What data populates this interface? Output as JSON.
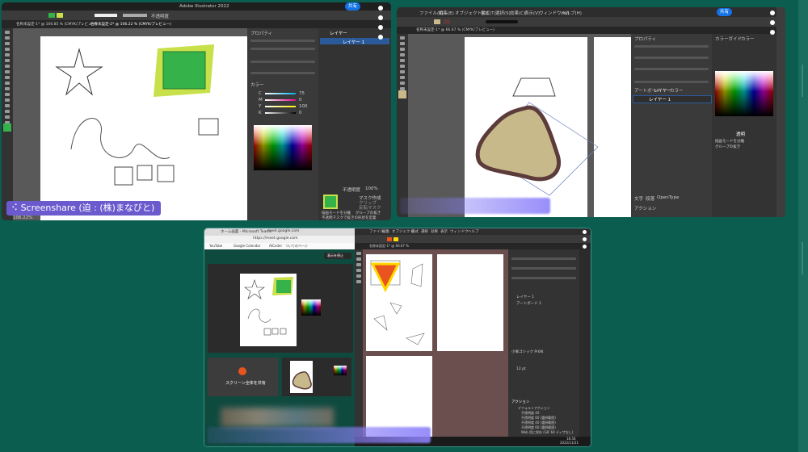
{
  "left_window": {
    "app_title": "Adobe Illustrator 2022",
    "share_label": "共有",
    "doc_tabs": [
      "名称未設定-1* @ 106.85 % (CMYK/プレビュー)",
      "名称未設定-2* @ 106.22 % (CMYK/プレビュー)"
    ],
    "panel_tabs": [
      "プロパティ",
      "レイヤー",
      "ライブラリ"
    ],
    "layer_name": "レイヤー 1",
    "swatch_tabs": [
      "カラー",
      "カラーガイド",
      "スウォッチ",
      "ブラシ",
      "シンボル"
    ],
    "color_channels": [
      {
        "label": "C",
        "value": "75"
      },
      {
        "label": "M",
        "value": "0"
      },
      {
        "label": "Y",
        "value": "100"
      },
      {
        "label": "K",
        "value": "0"
      }
    ],
    "opacity_label": "不透明度",
    "opacity_value": "100%",
    "mask_button": "マスク作成",
    "mask_options": [
      "クリップ",
      "反転マスク"
    ],
    "checkbox_group": "グループの抜き",
    "checkbox_clip": "描画モードを分離",
    "checkbox_define": "不透明マスクで抜きの形状を定義",
    "zoom_value": "106.22%",
    "screenshare_badge": "Screenshare (迫 : (株)まなびと)"
  },
  "right_window": {
    "menu": [
      "ファイル(F)",
      "編集(E)",
      "オブジェクト(O)",
      "書式(T)",
      "選択(S)",
      "効果(C)",
      "表示(V)",
      "ウィンドウ(W)",
      "ヘルプ(H)"
    ],
    "share_label": "共有",
    "doc_tab": "名称未設定-1* @ 66.67 % (CMYK/プレビュー)",
    "panel_tabs": [
      "プロパティ",
      "ライブラリ"
    ],
    "layer_tabs": [
      "アートボード",
      "レイヤー",
      "カラー"
    ],
    "layer_name": "レイヤー 1",
    "swatch_tabs": [
      "カラーガイド",
      "カラー"
    ],
    "transparency_tab": "透明",
    "checkbox_a": "描画モードを分離",
    "checkbox_b": "グループの抜き",
    "bottom_tabs": [
      "文字",
      "段落",
      "OpenType"
    ],
    "action_tab": "アクション"
  },
  "bottom_window": {
    "browser_tabs": [
      "ホーム画面 - Microsoft Teams",
      "meet.google.com"
    ],
    "url": "https://meet.google.com",
    "bookmarks": [
      "YouTube",
      "Google Calendar",
      "AtCoder",
      "ついてのページ"
    ],
    "screen_share_banner": "スクリーン全体を共有",
    "share_action": "表示を停止",
    "ai_doc_tab": "名称未設定-1* @ 66.67 %",
    "menu": [
      "ファイル",
      "編集",
      "オブジェクト",
      "書式",
      "選択",
      "効果",
      "表示",
      "ウィンドウ",
      "ヘルプ"
    ],
    "layer_items": [
      "レイヤー 1",
      "アートボード 1"
    ],
    "font_name": "小塚ゴシック Pr6N",
    "font_size": "12 pt",
    "layer_list_title": "アクション",
    "action_items": [
      "デフォルトアクション",
      "不透明度 40",
      "不透明度 60 (選択範囲)",
      "不透明度 40 (選択範囲)",
      "不透明度 60 (選択範囲)",
      "Web 用に保存 (GIF 64 ディザなし)"
    ],
    "taskbar_time": "18:56",
    "taskbar_date": "2022/11/21"
  },
  "colors": {
    "background": "#0b5e4f",
    "ai_dark": "#2b2b2b",
    "accent_green": "#36b24a",
    "accent_lime": "#c8e04a",
    "tan": "#c8b98a",
    "blob_stroke": "#5c3b3b",
    "orange": "#e8541e",
    "share_blue": "#1473e6",
    "badge_purple": "#6a5acd"
  }
}
